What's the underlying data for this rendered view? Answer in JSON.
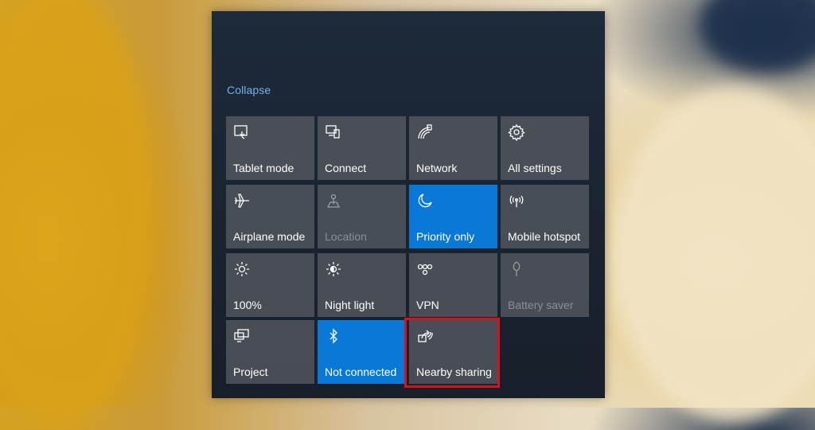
{
  "action_center": {
    "collapse_label": "Collapse",
    "tiles": [
      {
        "label": "Tablet mode",
        "icon": "tablet-mode-icon",
        "state": "off"
      },
      {
        "label": "Connect",
        "icon": "connect-icon",
        "state": "off"
      },
      {
        "label": "Network",
        "icon": "network-icon",
        "state": "off"
      },
      {
        "label": "All settings",
        "icon": "gear-icon",
        "state": "off"
      },
      {
        "label": "Airplane mode",
        "icon": "airplane-icon",
        "state": "off"
      },
      {
        "label": "Location",
        "icon": "location-icon",
        "state": "disabled"
      },
      {
        "label": "Priority only",
        "icon": "moon-icon",
        "state": "on"
      },
      {
        "label": "Mobile hotspot",
        "icon": "hotspot-icon",
        "state": "off"
      },
      {
        "label": "100%",
        "icon": "brightness-icon",
        "state": "off"
      },
      {
        "label": "Night light",
        "icon": "night-light-icon",
        "state": "off"
      },
      {
        "label": "VPN",
        "icon": "vpn-icon",
        "state": "off"
      },
      {
        "label": "Battery saver",
        "icon": "battery-saver-icon",
        "state": "disabled"
      },
      {
        "label": "Project",
        "icon": "project-icon",
        "state": "off"
      },
      {
        "label": "Not connected",
        "icon": "bluetooth-icon",
        "state": "on"
      },
      {
        "label": "Nearby sharing",
        "icon": "nearby-sharing-icon",
        "state": "off"
      }
    ],
    "highlighted_tile": "Nearby sharing"
  },
  "colors": {
    "accent_on": "#0a78d7",
    "tile_off": "#5a5e66",
    "link": "#6fb3e8",
    "highlight_box": "#d9111b"
  }
}
